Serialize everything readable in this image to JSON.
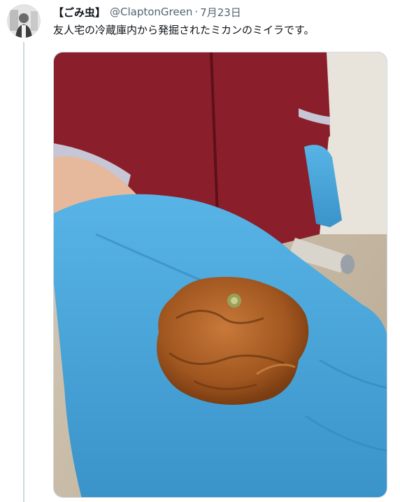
{
  "tweet": {
    "display_name": "【ごみ虫】",
    "handle": "@ClaptonGreen",
    "separator": "·",
    "date": "7月23日",
    "text": "友人宅の冷蔵庫内から発掘されたミカンのミイラです。"
  },
  "avatar": {
    "icon": "profile-photo"
  },
  "media": {
    "icon": "photo-gloved-hand-holding-mummified-mandarin"
  },
  "colors": {
    "text": "#0f1419",
    "secondary": "#536471",
    "border": "#cfd9de",
    "glove": "#4aa3d6",
    "sweater": "#8a1f2b",
    "mandarin": "#a0561f"
  }
}
